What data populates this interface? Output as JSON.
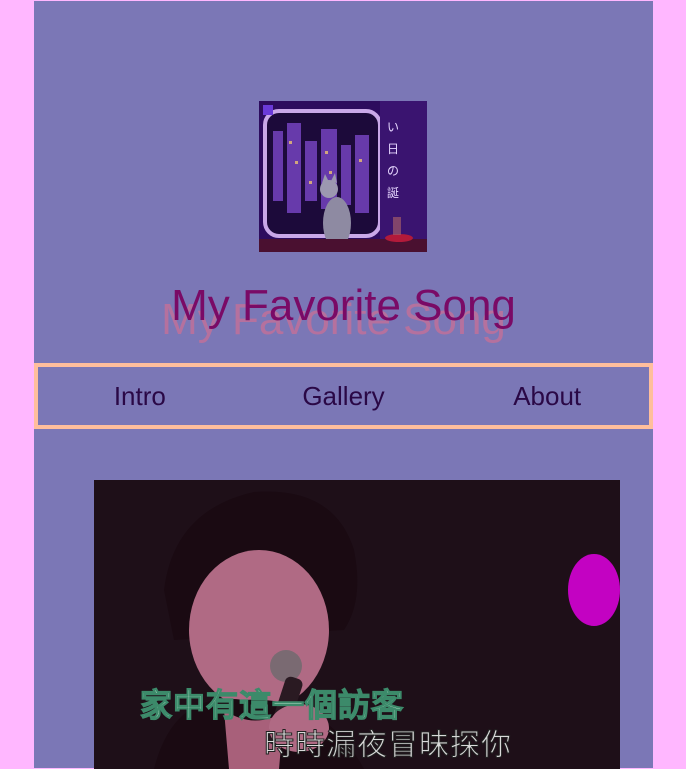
{
  "header": {
    "title": "My Favorite Song",
    "cover_art": "album-cover-cat-at-window"
  },
  "nav": {
    "items": [
      {
        "label": "Intro"
      },
      {
        "label": "Gallery"
      },
      {
        "label": "About"
      }
    ]
  },
  "video": {
    "subtitle_line1": "家中有這一個訪客",
    "subtitle_line2": "時時漏夜冒昧探你"
  },
  "colors": {
    "page_bg": "#ffb7ff",
    "panel_bg": "#7b77b6",
    "title": "#7a0a66",
    "nav_border": "#ffbe9c",
    "nav_text": "#2a0846"
  }
}
